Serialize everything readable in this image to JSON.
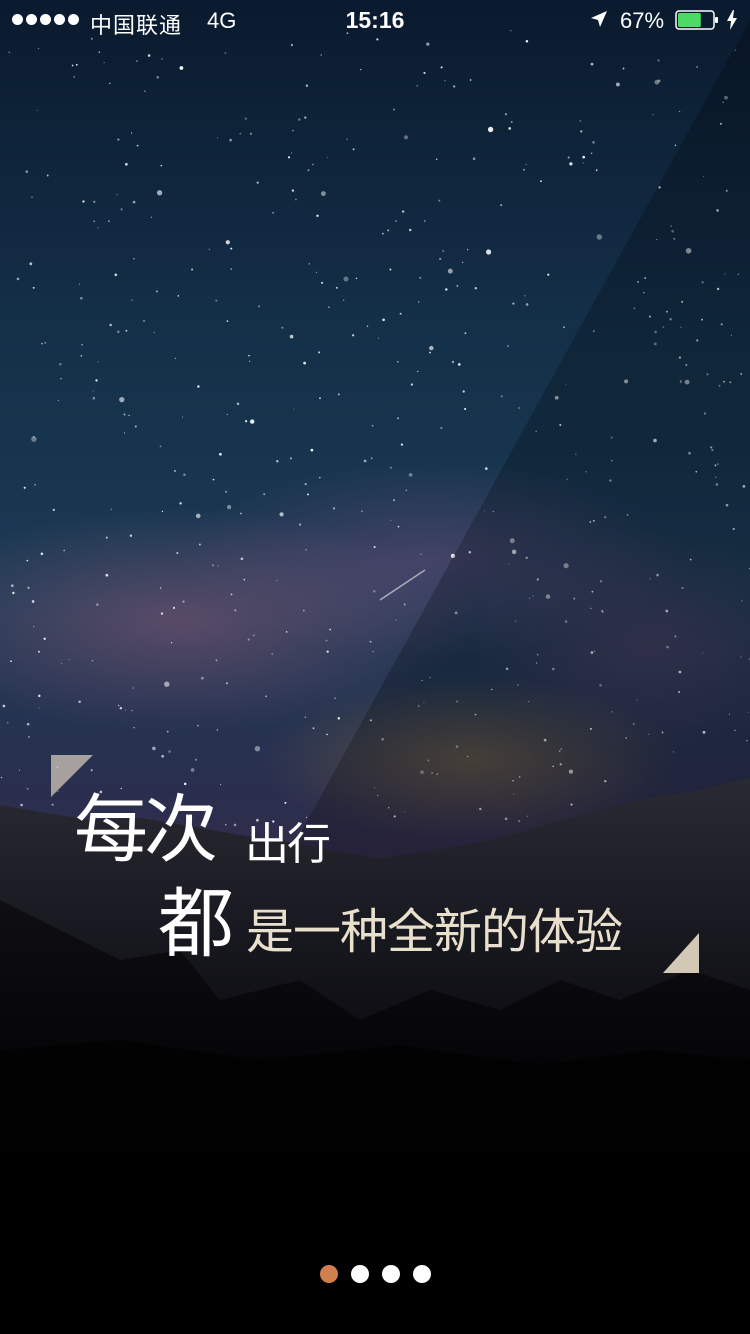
{
  "status_bar": {
    "carrier": "中国联通",
    "network": "4G",
    "time": "15:16",
    "battery_percent": "67%",
    "battery_level": 0.67,
    "icons": [
      "signal-dots-icon",
      "location-arrow-icon",
      "battery-icon",
      "charging-bolt-icon"
    ]
  },
  "slogan": {
    "line1_big": "每次",
    "line1_small": "出行",
    "line2_big": "都",
    "line2_small": "是一种全新的体验"
  },
  "page_indicator": {
    "count": 4,
    "active_index": 0
  },
  "colors": {
    "accent_dot": "#d27f4e",
    "inactive_dot": "#ffffff",
    "slogan_highlight": "#e9dfcd",
    "battery_fill": "#4cd964"
  }
}
